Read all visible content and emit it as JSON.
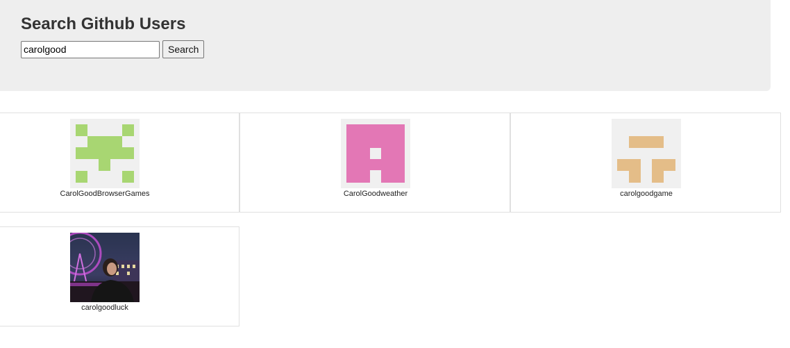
{
  "header": {
    "title": "Search Github Users",
    "search_value": "carolgood",
    "search_button_label": "Search"
  },
  "results": [
    {
      "login": "CarolGoodBrowserGames",
      "avatar": "identicon-green",
      "color": "#a8d672"
    },
    {
      "login": "CarolGoodweather",
      "avatar": "identicon-pink",
      "color": "#e377b5"
    },
    {
      "login": "carolgoodgame",
      "avatar": "identicon-tan",
      "color": "#e4bd88"
    },
    {
      "login": "carolgoodluck",
      "avatar": "photo-night-ferris-wheel"
    }
  ]
}
